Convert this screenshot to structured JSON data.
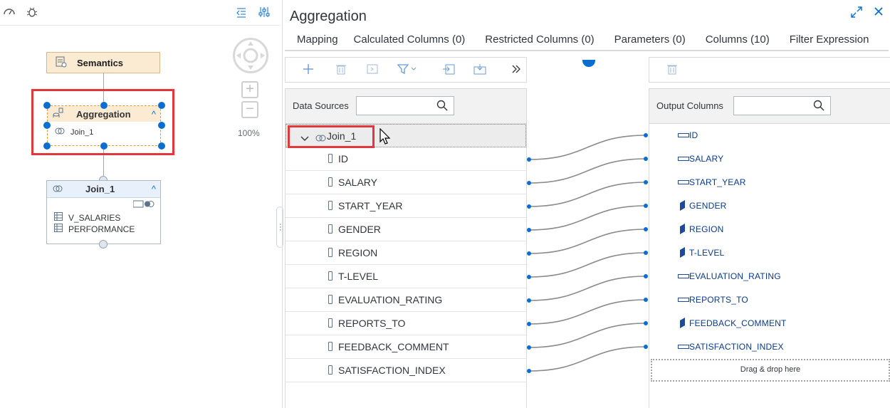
{
  "left_toolbar": {
    "icons": [
      "speedometer-icon",
      "bug-icon",
      "collapse-panel-icon",
      "settings-sliders-icon"
    ]
  },
  "diagram": {
    "semantics_node": {
      "label": "Semantics"
    },
    "aggregation_node": {
      "label": "Aggregation",
      "input": "Join_1"
    },
    "join_node": {
      "label": "Join_1",
      "sources": [
        "V_SALARIES",
        "PERFORMANCE"
      ]
    },
    "zoom_level": "100%"
  },
  "editor": {
    "title": "Aggregation",
    "tabs": [
      "Mapping",
      "Calculated Columns (0)",
      "Restricted Columns (0)",
      "Parameters (0)",
      "Columns (10)",
      "Filter Expression"
    ],
    "data_sources": {
      "label": "Data Sources",
      "search_value": "",
      "group": "Join_1",
      "columns": [
        "ID",
        "SALARY",
        "START_YEAR",
        "GENDER",
        "REGION",
        "T-LEVEL",
        "EVALUATION_RATING",
        "REPORTS_TO",
        "FEEDBACK_COMMENT",
        "SATISFACTION_INDEX"
      ]
    },
    "output_columns": {
      "label": "Output Columns",
      "search_value": "",
      "columns": [
        {
          "name": "ID",
          "kind": "measure"
        },
        {
          "name": "SALARY",
          "kind": "measure"
        },
        {
          "name": "START_YEAR",
          "kind": "measure"
        },
        {
          "name": "GENDER",
          "kind": "attribute"
        },
        {
          "name": "REGION",
          "kind": "attribute"
        },
        {
          "name": "T-LEVEL",
          "kind": "attribute"
        },
        {
          "name": "EVALUATION_RATING",
          "kind": "measure"
        },
        {
          "name": "REPORTS_TO",
          "kind": "measure"
        },
        {
          "name": "FEEDBACK_COMMENT",
          "kind": "attribute"
        },
        {
          "name": "SATISFACTION_INDEX",
          "kind": "measure"
        }
      ],
      "drop_hint": "Drag & drop here"
    }
  },
  "colors": {
    "accent": "#0a6ed1",
    "highlight": "#e1373d",
    "semantics_bg": "#fcebd3",
    "join_bg": "#e8f1fb"
  }
}
